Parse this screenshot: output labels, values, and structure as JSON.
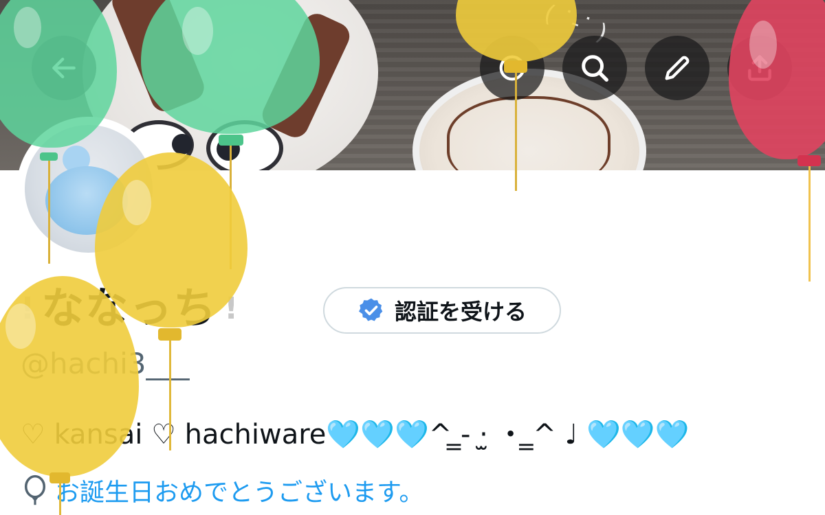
{
  "header": {
    "back_icon": "arrow-left-icon",
    "menu_icon": "more-icon",
    "search_icon": "search-icon",
    "edit_icon": "pencil-icon",
    "share_icon": "share-icon"
  },
  "banner": {
    "smiley_text": "( ˙-˙ )"
  },
  "profile": {
    "name_prefix": "!",
    "display_name": "ななっち",
    "name_suffix": "!",
    "verify_label": "認証を受ける",
    "verify_icon": "verified-badge-icon",
    "handle": "@hachi3___",
    "bio": "♡ kansai ♡ hachiware🩵🩵🩵^ ̳- ·̫ ・ ̳^ ♩ 🩵🩵🩵",
    "birthday_icon": "balloon-icon",
    "birthday_text": "お誕生日おめでとうございます。"
  },
  "colors": {
    "accent_blue": "#1d9bf0",
    "balloon_green": "#5ed59c",
    "balloon_yellow": "#f0cc3c",
    "balloon_red": "#e0445f",
    "verified_blue": "#4a8fe8"
  }
}
